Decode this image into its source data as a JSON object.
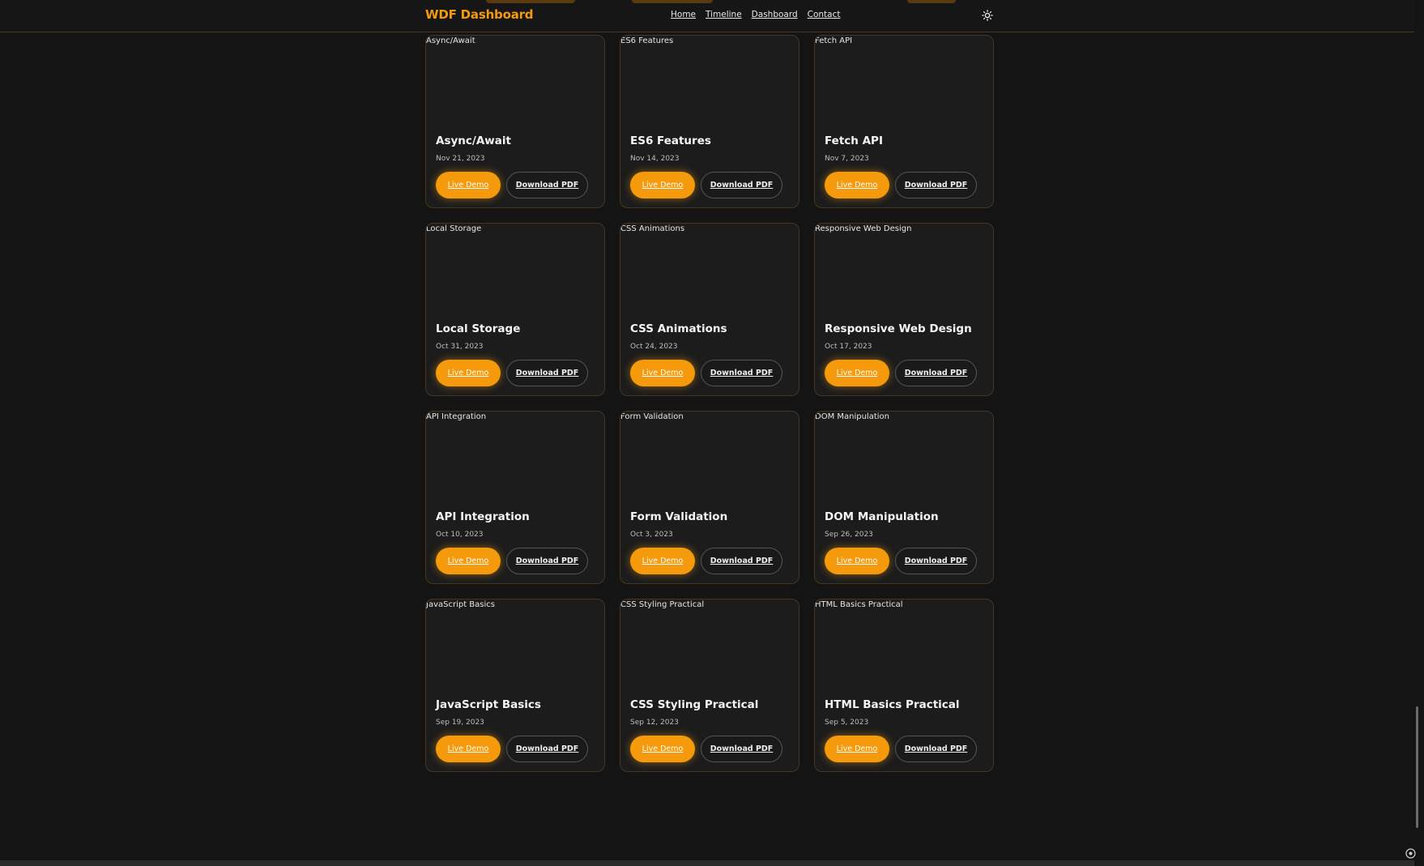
{
  "brand": "WDF Dashboard",
  "nav": [
    {
      "label": "Home"
    },
    {
      "label": "Timeline"
    },
    {
      "label": "Dashboard"
    },
    {
      "label": "Contact"
    }
  ],
  "theme_icon": "sun-icon",
  "accent_color": "#f59a0c",
  "cards": [
    {
      "alt": "Async/Await",
      "title": "Async/Await",
      "date": "Nov 21, 2023",
      "demo_label": "Live Demo",
      "pdf_label": "Download PDF"
    },
    {
      "alt": "ES6 Features",
      "title": "ES6 Features",
      "date": "Nov 14, 2023",
      "demo_label": "Live Demo",
      "pdf_label": "Download PDF"
    },
    {
      "alt": "Fetch API",
      "title": "Fetch API",
      "date": "Nov 7, 2023",
      "demo_label": "Live Demo",
      "pdf_label": "Download PDF"
    },
    {
      "alt": "Local Storage",
      "title": "Local Storage",
      "date": "Oct 31, 2023",
      "demo_label": "Live Demo",
      "pdf_label": "Download PDF"
    },
    {
      "alt": "CSS Animations",
      "title": "CSS Animations",
      "date": "Oct 24, 2023",
      "demo_label": "Live Demo",
      "pdf_label": "Download PDF"
    },
    {
      "alt": "Responsive Web Design",
      "title": "Responsive Web Design",
      "date": "Oct 17, 2023",
      "demo_label": "Live Demo",
      "pdf_label": "Download PDF"
    },
    {
      "alt": "API Integration",
      "title": "API Integration",
      "date": "Oct 10, 2023",
      "demo_label": "Live Demo",
      "pdf_label": "Download PDF"
    },
    {
      "alt": "Form Validation",
      "title": "Form Validation",
      "date": "Oct 3, 2023",
      "demo_label": "Live Demo",
      "pdf_label": "Download PDF"
    },
    {
      "alt": "DOM Manipulation",
      "title": "DOM Manipulation",
      "date": "Sep 26, 2023",
      "demo_label": "Live Demo",
      "pdf_label": "Download PDF"
    },
    {
      "alt": "JavaScript Basics",
      "title": "JavaScript Basics",
      "date": "Sep 19, 2023",
      "demo_label": "Live Demo",
      "pdf_label": "Download PDF"
    },
    {
      "alt": "CSS Styling Practical",
      "title": "CSS Styling Practical",
      "date": "Sep 12, 2023",
      "demo_label": "Live Demo",
      "pdf_label": "Download PDF"
    },
    {
      "alt": "HTML Basics Practical",
      "title": "HTML Basics Practical",
      "date": "Sep 5, 2023",
      "demo_label": "Live Demo",
      "pdf_label": "Download PDF"
    }
  ]
}
